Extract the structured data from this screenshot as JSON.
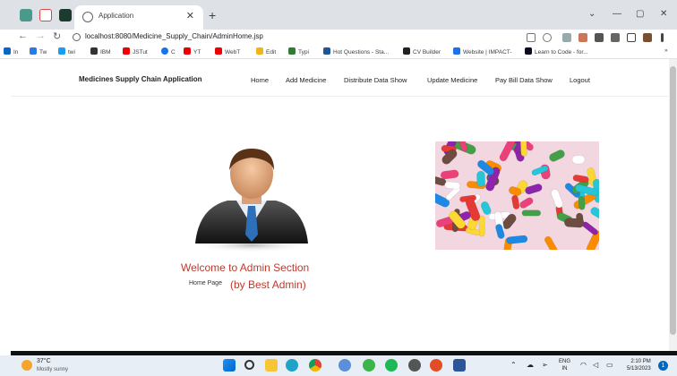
{
  "browser": {
    "tab_title": "Application",
    "url": "localhost:8080/Medicine_Supply_Chain/AdminHome.jsp",
    "bookmarks": [
      "In",
      "Tw",
      "twi",
      "IBM",
      "JSTut",
      "C",
      "YT",
      "WebT",
      "Edit",
      "Typi",
      "Hot Questions - Sta...",
      "CV Builder",
      "Website | IMPACT-",
      "Learn to Code - for..."
    ]
  },
  "app": {
    "brand": "Medicines Supply Chain Application",
    "nav": [
      "Home",
      "Add Medicine",
      "Distribute Data Show",
      "Update Medicine",
      "Pay Bill Data Show",
      "Logout"
    ]
  },
  "content": {
    "welcome": "Welcome to Admin Section",
    "home_page": "Home Page",
    "by_admin": "(by Best Admin)"
  },
  "taskbar": {
    "temp": "37°C",
    "weather": "Mostly sunny",
    "lang1": "ENG",
    "lang2": "IN",
    "time": "2:10 PM",
    "date": "5/13/2023",
    "notif_count": "1"
  },
  "colors": {
    "accent_text": "#c0392b",
    "tabstrip": "#dee1e6",
    "taskbar": "#e8eef6"
  }
}
